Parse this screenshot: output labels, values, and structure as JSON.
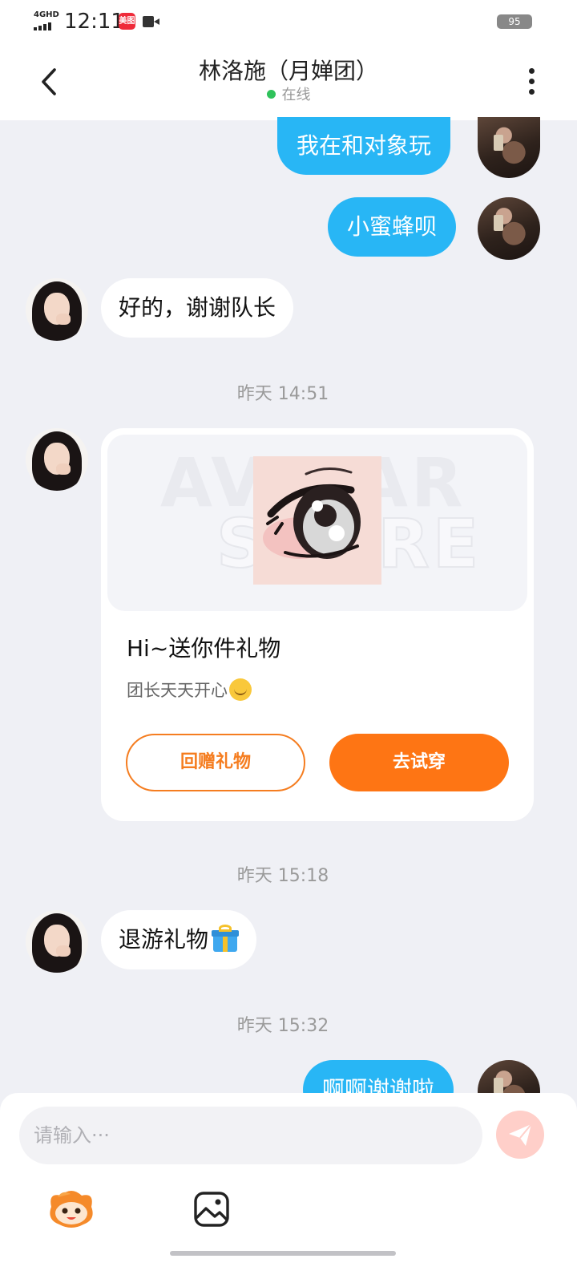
{
  "status_bar": {
    "network": "4GHD",
    "time": "12:11",
    "app_badge": "美图",
    "battery": "95"
  },
  "header": {
    "title": "林洛施（月婵团）",
    "status": "在线",
    "status_color": "#2fc25b"
  },
  "messages": {
    "m1": "我在和对象玩",
    "m2": "小蜜蜂呗",
    "m3": "好的，谢谢队长",
    "ts1": "昨天 14:51",
    "gift_card": {
      "watermark_line1": "AVATAR",
      "watermark_line2": "STORE",
      "title": "Hi~送你件礼物",
      "subtitle": "团长天天开心",
      "subtitle_emoji": "smile-emoji",
      "return_gift_button": "回赠礼物",
      "try_on_button": "去试穿"
    },
    "ts2": "昨天 15:18",
    "m4": "退游礼物",
    "m4_emoji": "gift-emoji",
    "ts3": "昨天 15:32",
    "m5": "啊啊谢谢啦"
  },
  "composer": {
    "placeholder": "请输入···",
    "send_icon": "paper-plane-icon",
    "tools": [
      "mascot-sticker-icon",
      "image-icon"
    ]
  },
  "colors": {
    "self_bubble": "#28b6f5",
    "accent_orange": "#fe7514",
    "background": "#eff0f5"
  }
}
